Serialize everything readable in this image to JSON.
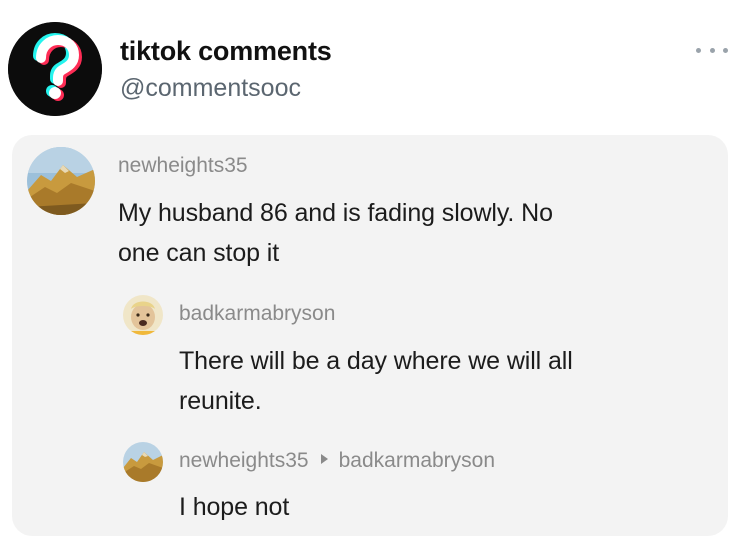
{
  "post": {
    "account_name": "tiktok comments",
    "account_handle": "@commentsooc",
    "avatar_icon": "question-mark-icon",
    "more_icon": "ellipsis-icon"
  },
  "comments": [
    {
      "username": "newheights35",
      "text_line1": "My husband 86 and is fading slowly. No",
      "text_line2": "one can stop it"
    },
    {
      "username": "badkarmabryson",
      "text_line1": "There will be a day where we will all",
      "text_line2": "reunite."
    },
    {
      "username": "newheights35",
      "reply_to": "badkarmabryson",
      "text_line1": "I hope not"
    }
  ],
  "colors": {
    "card_background": "#f3f3f3",
    "username_gray": "#8a8a8a",
    "handle_gray": "#5b6670",
    "text_dark": "#1c1c1c"
  }
}
